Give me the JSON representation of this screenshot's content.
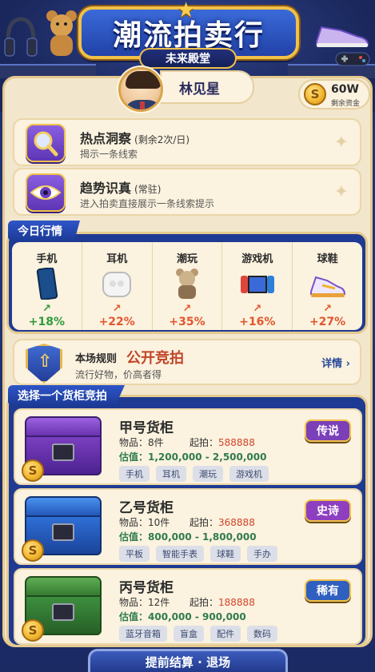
{
  "header": {
    "title": "潮流拍卖行",
    "subtitle": "未来殿堂"
  },
  "player": {
    "name": "林见星",
    "funds": "60W",
    "funds_label": "剩余资金",
    "coin_symbol": "S"
  },
  "skills": [
    {
      "title": "热点洞察",
      "note": "(剩余2次/日)",
      "desc": "揭示一条线索",
      "icon": "magnifier-icon"
    },
    {
      "title": "趋势识真",
      "note": "(常驻)",
      "desc": "进入拍卖直接展示一条线索提示",
      "icon": "eye-icon"
    }
  ],
  "market": {
    "label": "今日行情",
    "items": [
      {
        "name": "手机",
        "change": "+18%",
        "trend": "green",
        "icon": "phone-icon"
      },
      {
        "name": "耳机",
        "change": "+22%",
        "trend": "red",
        "icon": "earbuds-icon"
      },
      {
        "name": "潮玩",
        "change": "+35%",
        "trend": "red",
        "icon": "bear-toy-icon"
      },
      {
        "name": "游戏机",
        "change": "+16%",
        "trend": "red",
        "icon": "game-console-icon"
      },
      {
        "name": "球鞋",
        "change": "+27%",
        "trend": "red",
        "icon": "sneaker-icon"
      }
    ]
  },
  "rules": {
    "label": "本场规则",
    "mode": "公开竞拍",
    "desc": "流行好物，价高者得",
    "detail": "详情 ›"
  },
  "cabinets_section": {
    "label": "选择一个货柜竞拍",
    "items_label": "物品：",
    "start_label": "起拍：",
    "est_label": "估值："
  },
  "cabinets": [
    {
      "title": "甲号货柜",
      "items": "8件",
      "start": "588888",
      "estimate": "1,200,000 - 2,500,000",
      "rarity": "传说",
      "rarity_color": "#7b3fb8",
      "chest_color": "#7a3fc0",
      "tags": [
        "手机",
        "耳机",
        "潮玩",
        "游戏机"
      ]
    },
    {
      "title": "乙号货柜",
      "items": "10件",
      "start": "368888",
      "estimate": "800,000 - 1,800,000",
      "rarity": "史诗",
      "rarity_color": "#8e3fbf",
      "chest_color": "#2f6fd6",
      "tags": [
        "平板",
        "智能手表",
        "球鞋",
        "手办"
      ]
    },
    {
      "title": "丙号货柜",
      "items": "12件",
      "start": "188888",
      "estimate": "400,000 - 900,000",
      "rarity": "稀有",
      "rarity_color": "#2f5fbf",
      "chest_color": "#3d8f3f",
      "tags": [
        "蓝牙音箱",
        "盲盒",
        "配件",
        "数码"
      ]
    }
  ],
  "footer": {
    "exit_label": "提前结算 · 退场"
  }
}
